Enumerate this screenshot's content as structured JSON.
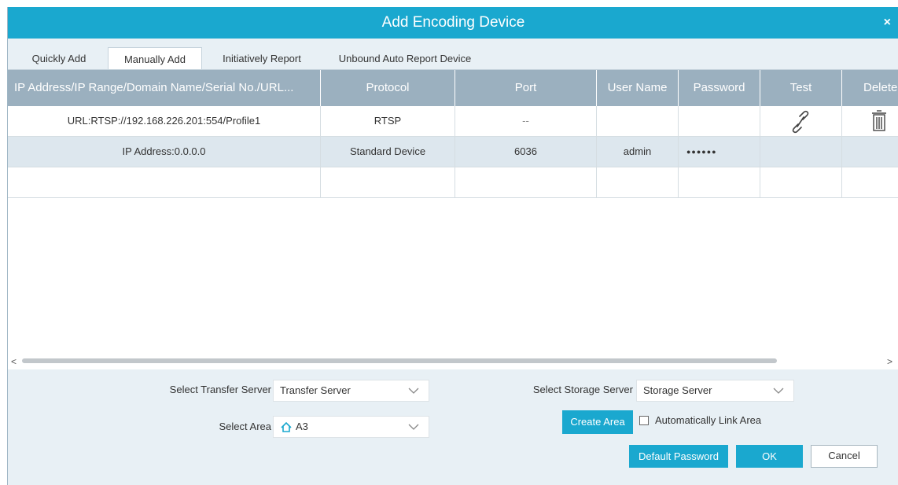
{
  "dialog": {
    "title": "Add  Encoding Device",
    "close": "×"
  },
  "tabs": [
    {
      "label": "Quickly Add"
    },
    {
      "label": "Manually Add"
    },
    {
      "label": "Initiatively Report"
    },
    {
      "label": "Unbound Auto Report Device"
    }
  ],
  "table": {
    "headers": [
      "IP Address/IP Range/Domain Name/Serial No./URL...",
      "Protocol",
      "Port",
      "User Name",
      "Password",
      "Test",
      "Delete"
    ],
    "rows": [
      {
        "address": "URL:RTSP://192.168.226.201:554/Profile1",
        "protocol": "RTSP",
        "port": "--",
        "username": "",
        "password": ""
      },
      {
        "address": "IP Address:0.0.0.0",
        "protocol": "Standard Device",
        "port": "6036",
        "username": "admin",
        "password": "●●●●●●"
      },
      {
        "address": "",
        "protocol": "",
        "port": "",
        "username": "",
        "password": ""
      }
    ]
  },
  "scroll": {
    "left": "<",
    "right": ">"
  },
  "form": {
    "transfer_label": "Select Transfer Server",
    "transfer_value": "Transfer Server",
    "area_label": "Select Area",
    "area_value": "A3",
    "storage_label": "Select Storage Server",
    "storage_value": "Storage Server",
    "create_area": "Create Area",
    "auto_link": "Automatically Link Area"
  },
  "buttons": {
    "default_password": "Default Password",
    "ok": "OK",
    "cancel": "Cancel"
  },
  "colors": {
    "accent": "#1aa8cf",
    "header": "#9bb0bf"
  }
}
